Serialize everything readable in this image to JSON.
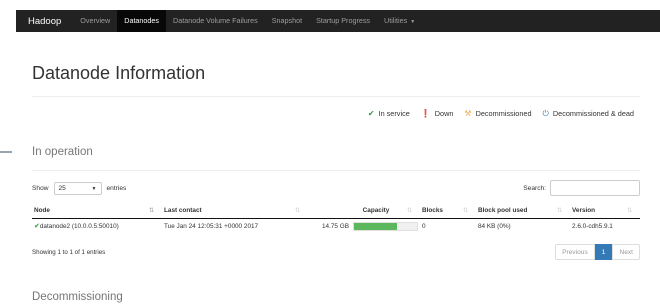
{
  "navbar": {
    "brand": "Hadoop",
    "items": [
      {
        "label": "Overview"
      },
      {
        "label": "Datanodes"
      },
      {
        "label": "Datanode Volume Failures"
      },
      {
        "label": "Snapshot"
      },
      {
        "label": "Startup Progress"
      },
      {
        "label": "Utilities"
      }
    ],
    "active_index": 1
  },
  "page_title": "Datanode Information",
  "legend": [
    {
      "label": "In service",
      "icon": "check-icon",
      "color": "#3c9a3c"
    },
    {
      "label": "Down",
      "icon": "down-icon",
      "color": "#c9302c"
    },
    {
      "label": "Decommissioned",
      "icon": "wrench-icon",
      "color": "#f0ad4e"
    },
    {
      "label": "Decommissioned & dead",
      "icon": "power-icon",
      "color": "#337ab7"
    }
  ],
  "in_operation": {
    "title": "In operation",
    "show_label": "Show",
    "entries_select": "25",
    "entries_label": "entries",
    "search_label": "Search:",
    "search_value": "",
    "columns": [
      "Node",
      "Last contact",
      "Capacity",
      "Blocks",
      "Block pool used",
      "Version"
    ],
    "rows": [
      {
        "node": "datanode2 (10.0.0.5:50010)",
        "last_contact": "Tue Jan 24 12:05:31 +0000 2017",
        "capacity": "14.75 GB",
        "capacity_used_fraction": 0.68,
        "blocks": "0",
        "block_pool_used": "84 KB (0%)",
        "version": "2.6.0-cdh5.9.1"
      }
    ],
    "showing_text": "Showing 1 to 1 of 1 entries",
    "pager": {
      "previous": "Previous",
      "current": "1",
      "next": "Next"
    }
  },
  "decommissioning": {
    "title": "Decommissioning"
  },
  "colors": {
    "navbar_bg": "#222222",
    "accent": "#337ab7",
    "capacity_bar": "#5cb85c"
  }
}
